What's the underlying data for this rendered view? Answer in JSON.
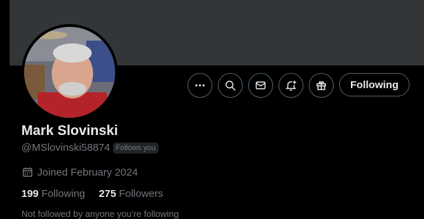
{
  "profile": {
    "name": "Mark Slovinski",
    "handle": "@MSlovinski58874",
    "follows_you_badge": "Follows you",
    "joined": "Joined February 2024",
    "following_count": "199",
    "following_label": "Following",
    "followers_count": "275",
    "followers_label": "Followers",
    "not_followed_text": "Not followed by anyone you’re following"
  },
  "actions": {
    "follow_button_label": "Following",
    "icons": [
      "more-icon",
      "search-icon",
      "message-icon",
      "notification-bell-icon",
      "gift-icon"
    ]
  },
  "colors": {
    "banner": "#333639",
    "background": "#000000",
    "text_primary": "#e7e9ea",
    "text_secondary": "#71767b",
    "button_border": "#536471"
  }
}
